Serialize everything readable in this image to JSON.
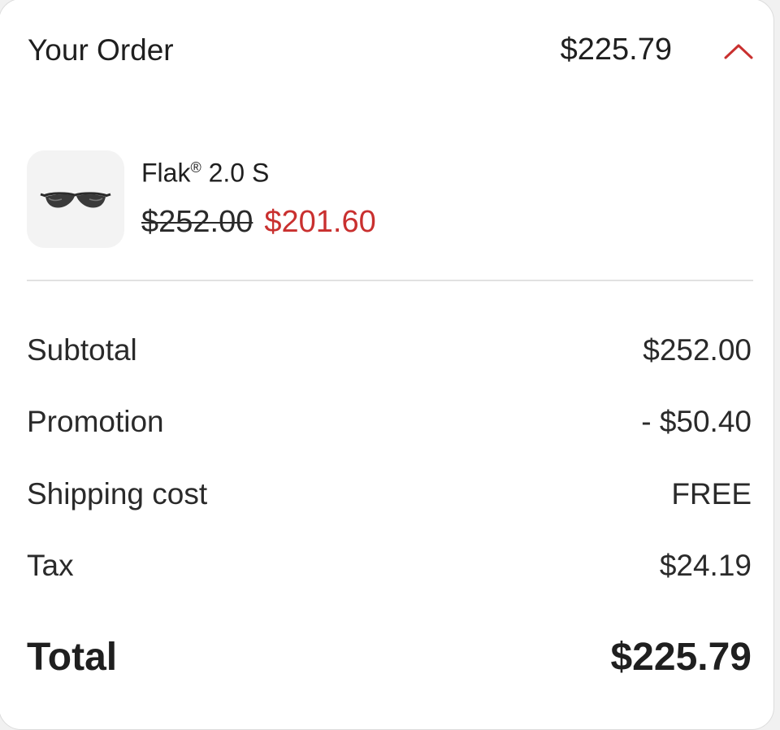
{
  "colors": {
    "accent_red": "#c9302f",
    "text": "#1f1f1f",
    "divider": "#e1e1e1"
  },
  "header": {
    "title": "Your Order",
    "total": "$225.79",
    "toggle_icon": "chevron-up-icon"
  },
  "product": {
    "name": "Flak",
    "name_mark": "®",
    "name_suffix": " 2.0 S",
    "original_price": "$252.00",
    "sale_price": "$201.60",
    "image_icon": "sunglasses-icon"
  },
  "summary": {
    "rows": [
      {
        "label": "Subtotal",
        "value": "$252.00"
      },
      {
        "label": "Promotion",
        "value": "- $50.40"
      },
      {
        "label": "Shipping cost",
        "value": "FREE"
      },
      {
        "label": "Tax",
        "value": "$24.19"
      }
    ],
    "total_label": "Total",
    "total_value": "$225.79"
  }
}
